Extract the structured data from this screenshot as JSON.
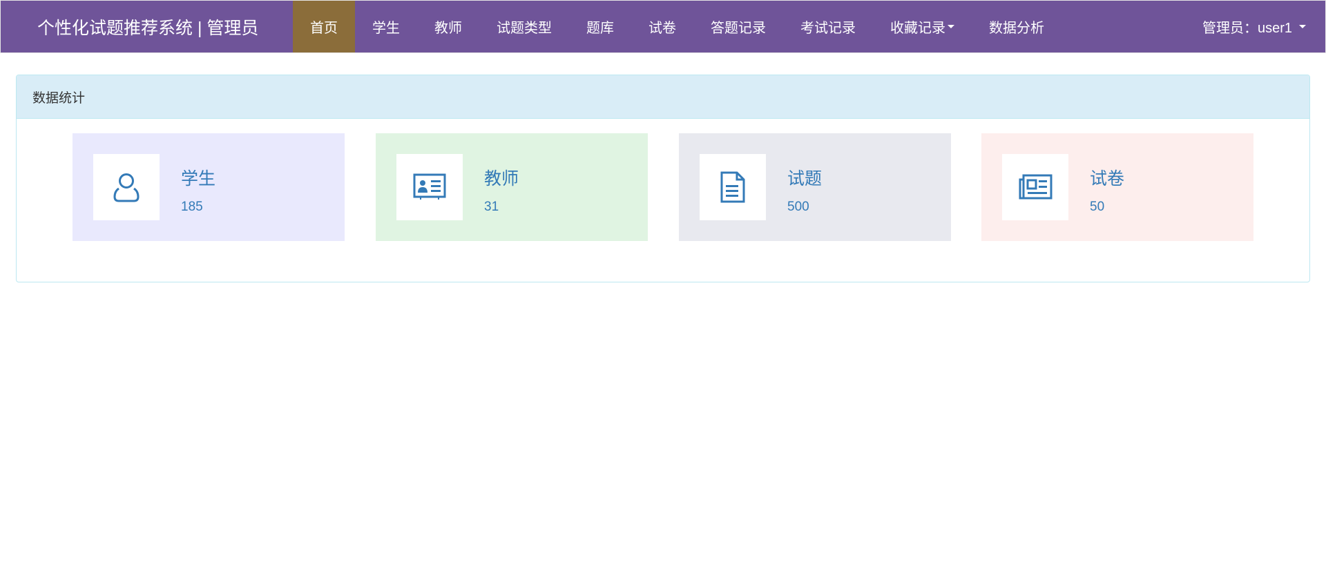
{
  "navbar": {
    "brand": "个性化试题推荐系统 | 管理员",
    "items": [
      {
        "label": "首页",
        "active": true
      },
      {
        "label": "学生"
      },
      {
        "label": "教师"
      },
      {
        "label": "试题类型"
      },
      {
        "label": "题库"
      },
      {
        "label": "试卷"
      },
      {
        "label": "答题记录"
      },
      {
        "label": "考试记录"
      },
      {
        "label": "收藏记录",
        "dropdown": true
      },
      {
        "label": "数据分析"
      }
    ],
    "user": "管理员：user1"
  },
  "panel": {
    "title": "数据统计",
    "cards": [
      {
        "label": "学生",
        "value": "185",
        "icon": "user-icon",
        "bg": "#e9e9fd"
      },
      {
        "label": "教师",
        "value": "31",
        "icon": "id-card-icon",
        "bg": "#e0f4e2"
      },
      {
        "label": "试题",
        "value": "500",
        "icon": "file-text-icon",
        "bg": "#e8e9ef"
      },
      {
        "label": "试卷",
        "value": "50",
        "icon": "newspaper-icon",
        "bg": "#fdeeed"
      }
    ]
  },
  "colors": {
    "navbar": "#6f5499",
    "active": "#8b6d3a",
    "accent": "#337ab7"
  }
}
